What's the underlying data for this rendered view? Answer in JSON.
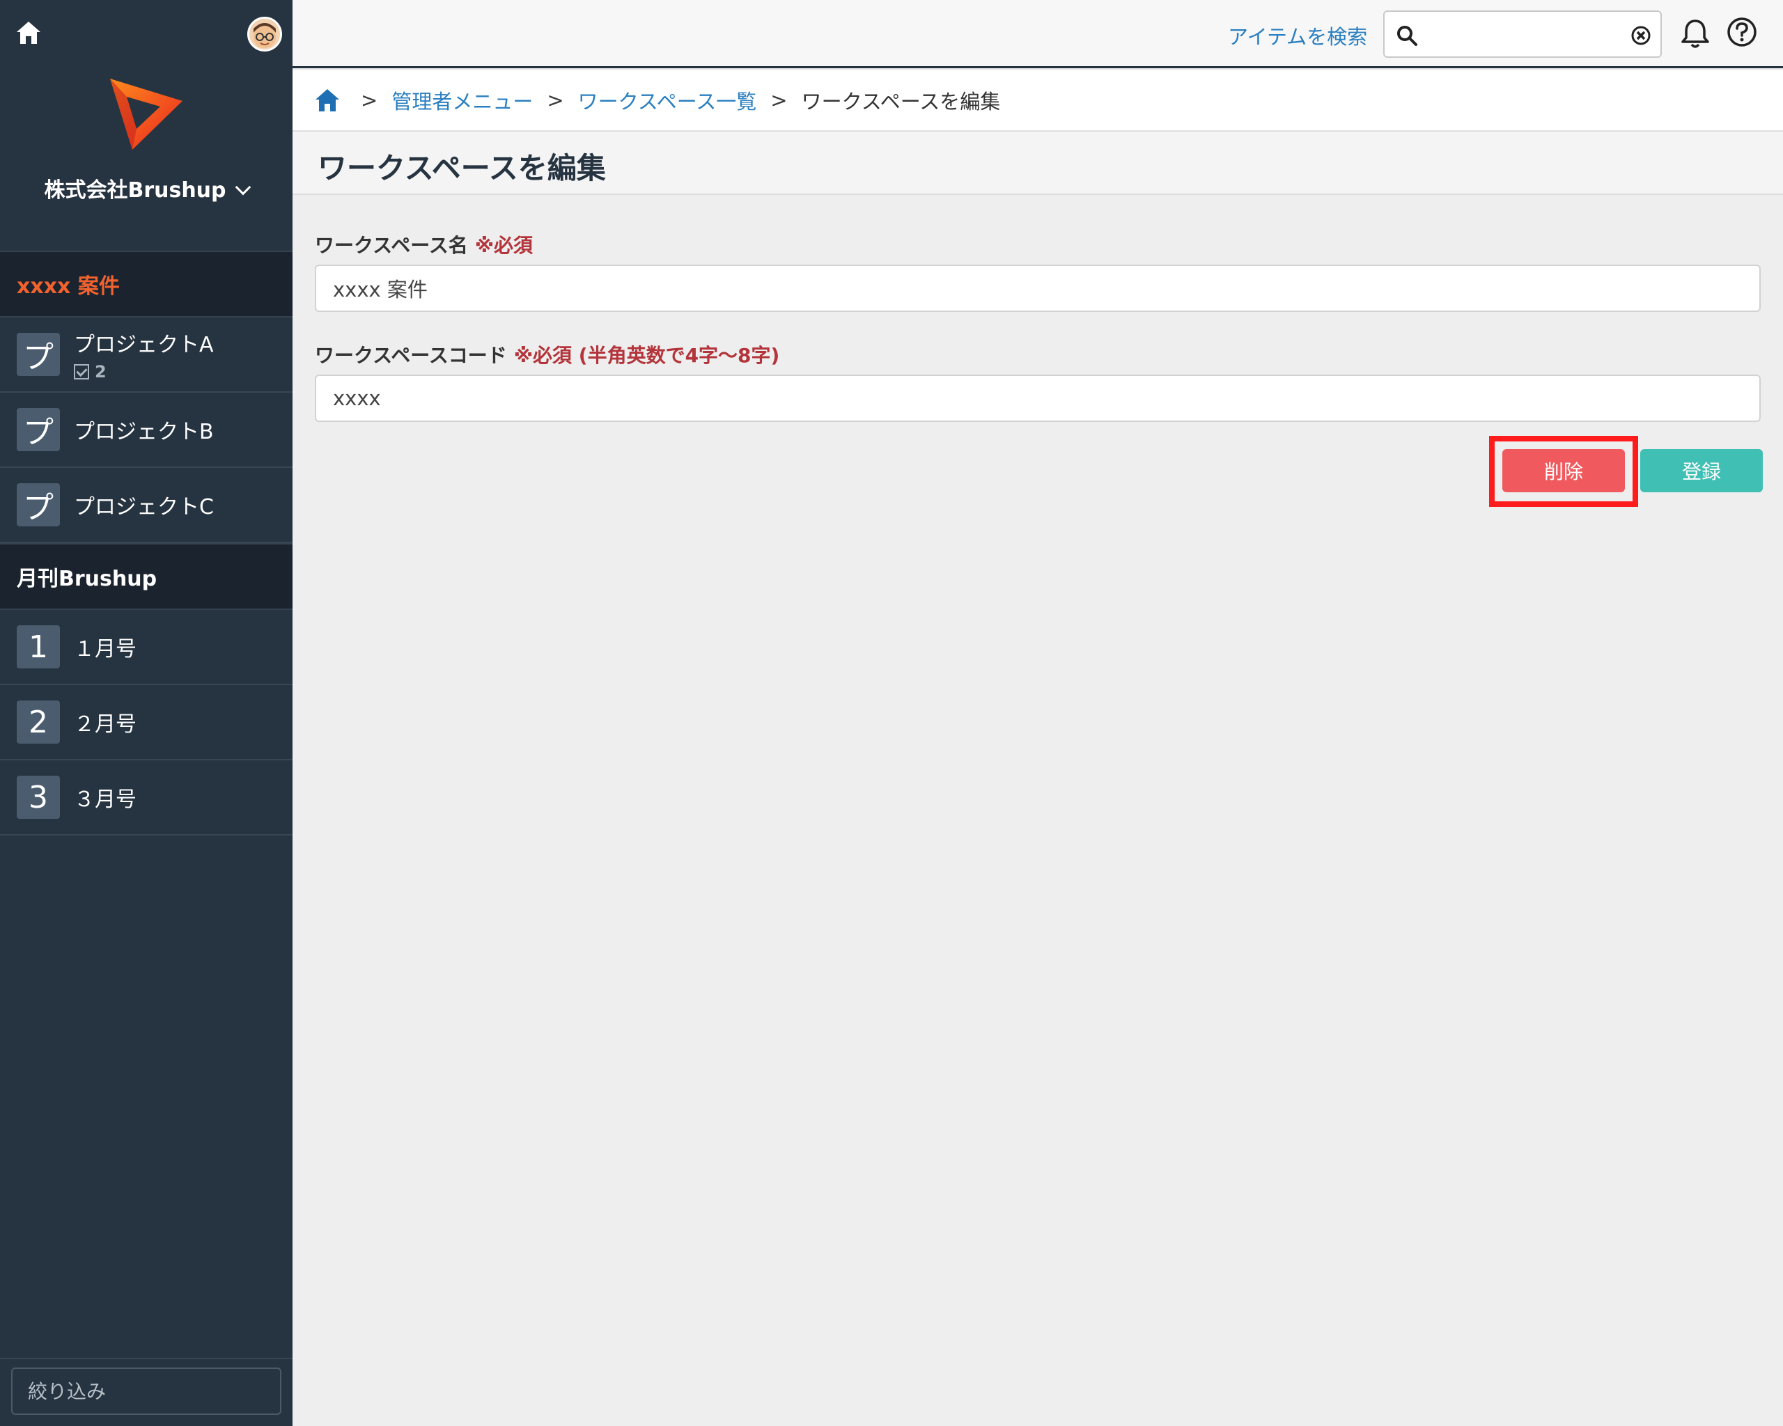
{
  "sidebar": {
    "company": "株式会社Brushup",
    "workspaces": [
      {
        "title": "xxxx 案件",
        "projects": [
          {
            "tile": "プ",
            "name": "プロジェクトA",
            "count": "2"
          },
          {
            "tile": "プ",
            "name": "プロジェクトB"
          },
          {
            "tile": "プ",
            "name": "プロジェクトC"
          }
        ]
      },
      {
        "title": "月刊Brushup",
        "projects": [
          {
            "tile": "1",
            "name": "１月号"
          },
          {
            "tile": "2",
            "name": "２月号"
          },
          {
            "tile": "3",
            "name": "３月号"
          }
        ]
      }
    ],
    "filter_placeholder": "絞り込み"
  },
  "topbar": {
    "search_link": "アイテムを検索",
    "search_value": ""
  },
  "breadcrumb": {
    "items": [
      "管理者メニュー",
      "ワークスペース一覧"
    ],
    "current": "ワークスペースを編集",
    "separator": ">"
  },
  "page": {
    "title": "ワークスペースを編集"
  },
  "form": {
    "name_label": "ワークスペース名",
    "name_required": "※必須",
    "name_value": "xxxx 案件",
    "code_label": "ワークスペースコード",
    "code_required": "※必須 (半角英数で4字〜8字)",
    "code_value": "xxxx",
    "delete_label": "削除",
    "register_label": "登録"
  },
  "colors": {
    "sidebar_bg": "#263340",
    "accent_orange": "#f2622e",
    "link_blue": "#2a7fc0",
    "delete_red": "#f05a5e",
    "register_teal": "#40bfb4",
    "highlight_frame": "#ff1c1c",
    "required_red": "#b3343a"
  },
  "icons": [
    "home-icon",
    "avatar",
    "brushup-logo",
    "chevron-down-icon",
    "checkbox-icon",
    "search-icon",
    "clear-icon",
    "bell-icon",
    "help-icon"
  ]
}
